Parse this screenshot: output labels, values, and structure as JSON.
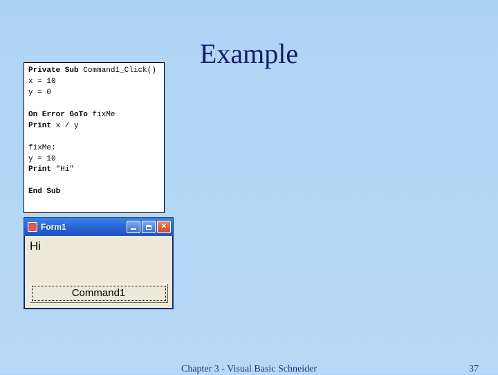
{
  "slide": {
    "title": "Example",
    "footer_center": "Chapter 3 - Visual Basic    Schneider",
    "footer_pagenum": "37"
  },
  "code": {
    "line1_kw1": "Private Sub",
    "line1_rest": " Command1_Click()",
    "line2": "x = 10",
    "line3": "y = 0",
    "blank1": "",
    "line4_kw": "On Error GoTo",
    "line4_rest": " fixMe",
    "line5_kw": "Print",
    "line5_rest": " x / y",
    "blank2": "",
    "line6": "fixMe:",
    "line7": "y = 10",
    "line8_kw": "Print",
    "line8_rest": " \"Hi\"",
    "blank3": "",
    "line9_kw": "End Sub"
  },
  "form": {
    "title": "Form1",
    "output": "Hi",
    "button_label": "Command1",
    "minimize_tip": "Minimize",
    "maximize_tip": "Maximize",
    "close_tip": "Close",
    "close_glyph": "✕"
  }
}
